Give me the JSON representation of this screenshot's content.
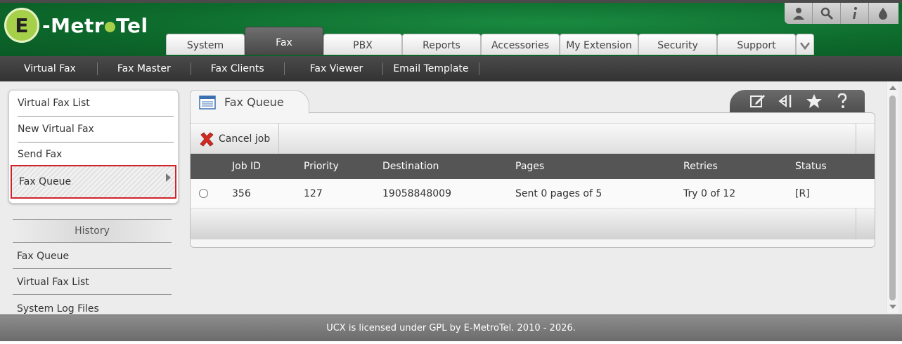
{
  "header": {
    "logo_letter": "E",
    "logo_text_a": "-Metr",
    "logo_text_b": "Tel",
    "tools": [
      "user-icon",
      "search-icon",
      "info-icon",
      "drop-icon"
    ]
  },
  "tabs": [
    {
      "label": "System",
      "active": false
    },
    {
      "label": "Fax",
      "active": true
    },
    {
      "label": "PBX",
      "active": false
    },
    {
      "label": "Reports",
      "active": false
    },
    {
      "label": "Accessories",
      "active": false
    },
    {
      "label": "My Extension",
      "active": false
    },
    {
      "label": "Security",
      "active": false
    },
    {
      "label": "Support",
      "active": false
    }
  ],
  "subnav": [
    "Virtual Fax",
    "Fax Master",
    "Fax Clients",
    "Fax Viewer",
    "Email Template"
  ],
  "sidebar": {
    "items": [
      "Virtual Fax List",
      "New Virtual Fax",
      "Send Fax",
      "Fax Queue"
    ],
    "selected": "Fax Queue",
    "history_title": "History",
    "history_items": [
      "Fax Queue",
      "Virtual Fax List",
      "System Log Files"
    ]
  },
  "panel": {
    "title": "Fax Queue",
    "tools": [
      "edit-icon",
      "collapse-icon",
      "star-icon",
      "help-icon"
    ],
    "cancel_label": "Cancel job",
    "columns": [
      "Job ID",
      "Priority",
      "Destination",
      "Pages",
      "Retries",
      "Status"
    ],
    "rows": [
      {
        "job_id": "356",
        "priority": "127",
        "destination": "19058848009",
        "pages": "Sent 0 pages of 5",
        "retries": "Try 0 of 12",
        "status": "[R]"
      }
    ]
  },
  "footer": {
    "text": "UCX is licensed under GPL by E-MetroTel. 2010 - 2026."
  }
}
